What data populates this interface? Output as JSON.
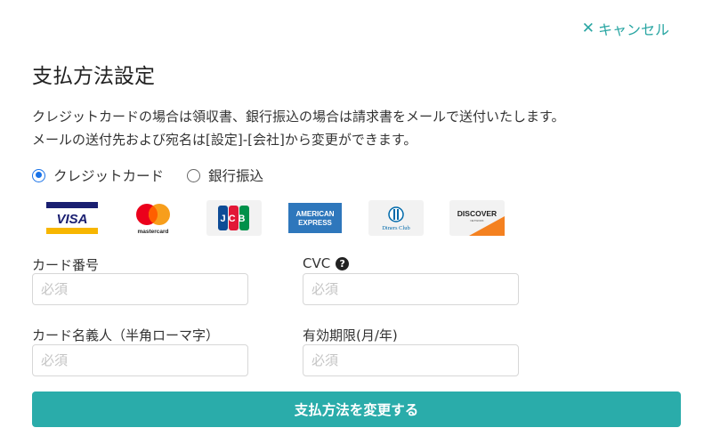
{
  "header": {
    "cancel_label": "キャンセル",
    "title": "支払方法設定"
  },
  "description": {
    "line1": "クレジットカードの場合は領収書、銀行振込の場合は請求書をメールで送付いたします。",
    "line2": "メールの送付先および宛名は[設定]-[会社]から変更ができます。"
  },
  "payment_methods": [
    {
      "label": "クレジットカード",
      "selected": true
    },
    {
      "label": "銀行振込",
      "selected": false
    }
  ],
  "card_brands": [
    {
      "name": "VISA",
      "icon": "visa-logo"
    },
    {
      "name": "mastercard",
      "icon": "mastercard-logo"
    },
    {
      "name": "JCB",
      "icon": "jcb-logo"
    },
    {
      "name": "AMERICAN EXPRESS",
      "icon": "amex-logo"
    },
    {
      "name": "Diners Club",
      "icon": "diners-logo"
    },
    {
      "name": "DISCOVER",
      "icon": "discover-logo"
    }
  ],
  "form": {
    "card_number": {
      "label": "カード番号",
      "placeholder": "必須",
      "value": ""
    },
    "cvc": {
      "label": "CVC",
      "placeholder": "必須",
      "value": "",
      "help_icon": "question-circle-icon"
    },
    "card_holder": {
      "label": "カード名義人（半角ローマ字）",
      "placeholder": "必須",
      "value": ""
    },
    "expiry": {
      "label": "有効期限(月/年)",
      "placeholder": "必須",
      "value": ""
    }
  },
  "submit_label": "支払方法を変更する",
  "colors": {
    "accent": "#2aacaa",
    "link": "#2aa6a3",
    "radio_selected": "#1a73e8"
  }
}
